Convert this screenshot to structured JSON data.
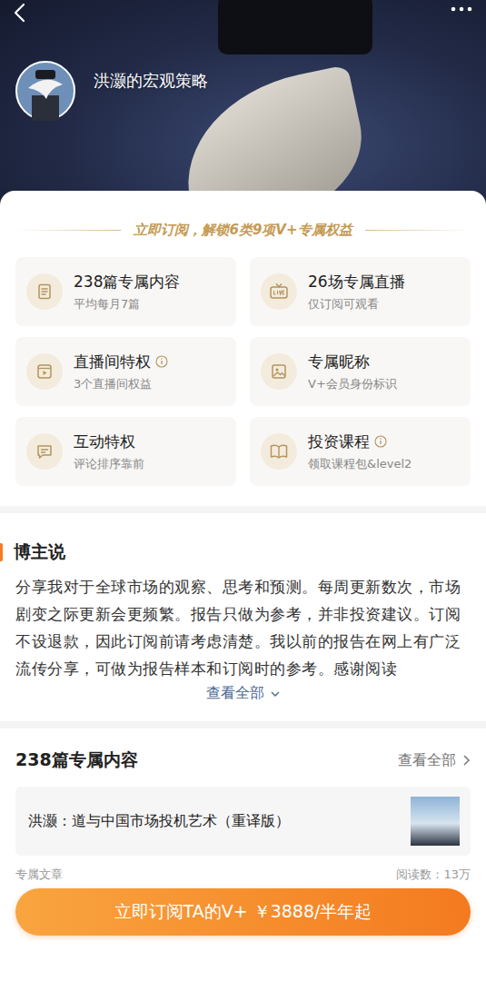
{
  "profile": {
    "name": "洪灏的宏观策略"
  },
  "benefits": {
    "title": "立即订阅，解锁6类9项V+专属权益",
    "items": [
      {
        "kind": "articles",
        "title": "238篇专属内容",
        "subtitle": "平均每月7篇",
        "info": false
      },
      {
        "kind": "live",
        "title": "26场专属直播",
        "subtitle": "仅订阅可观看",
        "info": false
      },
      {
        "kind": "room",
        "title": "直播间特权",
        "subtitle": "3个直播间权益",
        "info": true
      },
      {
        "kind": "nickname",
        "title": "专属昵称",
        "subtitle": "V+会员身份标识",
        "info": false
      },
      {
        "kind": "interact",
        "title": "互动特权",
        "subtitle": "评论排序靠前",
        "info": false
      },
      {
        "kind": "course",
        "title": "投资课程",
        "subtitle": "领取课程包&level2",
        "info": true
      }
    ]
  },
  "about": {
    "title": "博主说",
    "text": "分享我对于全球市场的观察、思考和预测。每周更新数次，市场剧变之际更新会更频繁。报告只做为参考，并非投资建议。订阅不设退款，因此订阅前请考虑清楚。我以前的报告在网上有广泛流传分享，可做为报告样本和订阅时的参考。感谢阅读",
    "more": "查看全部"
  },
  "content": {
    "title": "238篇专属内容",
    "more": "查看全部",
    "items": [
      {
        "title": "洪灏：道与中国市场投机艺术（重译版）",
        "type": "专属文章",
        "reads": "阅读数：13万"
      }
    ]
  },
  "cta": {
    "label": "立即订阅TA的V+ ￥3888/半年起"
  }
}
